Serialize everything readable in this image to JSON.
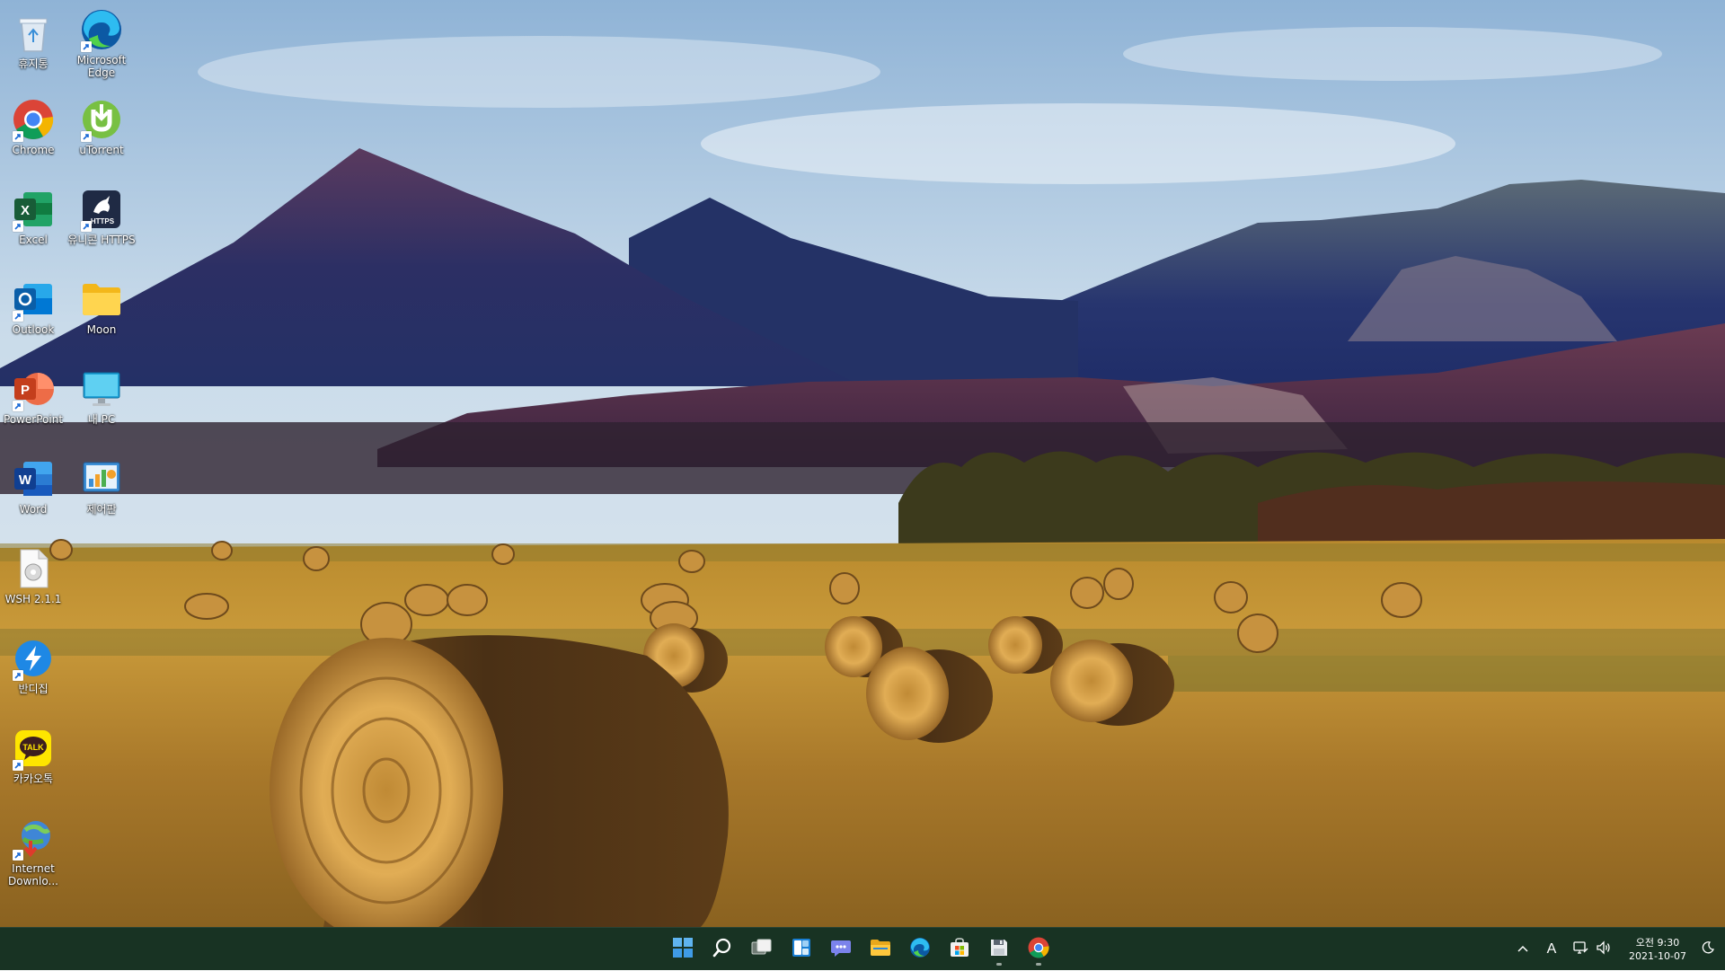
{
  "desktop": {
    "icons": [
      {
        "label": "휴지통",
        "icon": "recycle-bin-icon"
      },
      {
        "label": "Microsoft Edge",
        "icon": "edge-icon"
      },
      {
        "label": "Chrome",
        "icon": "chrome-icon"
      },
      {
        "label": "uTorrent",
        "icon": "utorrent-icon"
      },
      {
        "label": "Excel",
        "icon": "excel-icon"
      },
      {
        "label": "유니콘 HTTPS",
        "icon": "unicorn-https-icon"
      },
      {
        "label": "Outlook",
        "icon": "outlook-icon"
      },
      {
        "label": "Moon",
        "icon": "folder-icon"
      },
      {
        "label": "PowerPoint",
        "icon": "powerpoint-icon"
      },
      {
        "label": "내 PC",
        "icon": "monitor-icon"
      },
      {
        "label": "Word",
        "icon": "word-icon"
      },
      {
        "label": "제어판",
        "icon": "control-panel-icon"
      },
      {
        "label": "WSH 2.1.1",
        "icon": "document-icon"
      },
      {
        "label": "반디집",
        "icon": "bandizip-icon"
      },
      {
        "label": "카카오톡",
        "icon": "kakaotalk-icon"
      },
      {
        "label": "Internet Downlo...",
        "icon": "internet-download-manager-icon"
      }
    ],
    "kakaotalk_badge": "TALK",
    "unicorn_badge": "HTTPS"
  },
  "taskbar": {
    "pinned": [
      {
        "name": "start",
        "icon": "windows-start-icon",
        "running": false
      },
      {
        "name": "search",
        "icon": "search-icon",
        "running": false
      },
      {
        "name": "task-view",
        "icon": "task-view-icon",
        "running": false
      },
      {
        "name": "widgets",
        "icon": "widgets-icon",
        "running": false
      },
      {
        "name": "chat",
        "icon": "teams-chat-icon",
        "running": false
      },
      {
        "name": "file-explorer",
        "icon": "file-explorer-icon",
        "running": false
      },
      {
        "name": "edge",
        "icon": "edge-icon",
        "running": false
      },
      {
        "name": "store",
        "icon": "microsoft-store-icon",
        "running": false
      },
      {
        "name": "save-app",
        "icon": "floppy-disk-icon",
        "running": true
      },
      {
        "name": "chrome",
        "icon": "chrome-icon",
        "running": true
      }
    ],
    "tray": {
      "ime": "A",
      "time": "오전 9:30",
      "date": "2021-10-07"
    },
    "colors": {
      "background": "#183323"
    }
  }
}
